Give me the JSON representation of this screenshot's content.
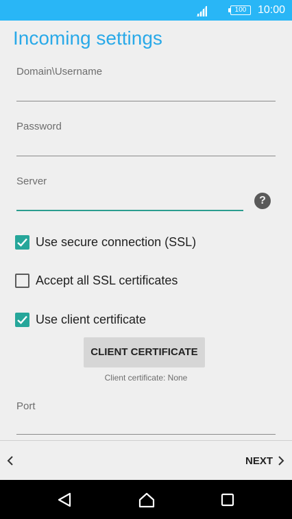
{
  "status_bar": {
    "battery_level": "100",
    "time": "10:00"
  },
  "header": {
    "title": "Incoming settings"
  },
  "fields": {
    "username_label": "Domain\\Username",
    "password_label": "Password",
    "server_label": "Server",
    "port_label": "Port"
  },
  "options": {
    "ssl_label": "Use secure connection (SSL)",
    "ssl_checked": true,
    "accept_all_label": "Accept all SSL certificates",
    "accept_all_checked": false,
    "client_cert_label": "Use client certificate",
    "client_cert_checked": true
  },
  "client_certificate": {
    "button_label": "CLIENT CERTIFICATE",
    "status_text": "Client certificate: None"
  },
  "nav": {
    "next_label": "NEXT"
  },
  "colors": {
    "accent": "#29a9e8",
    "checkbox": "#26a69a",
    "status_bar": "#29b6f6"
  }
}
